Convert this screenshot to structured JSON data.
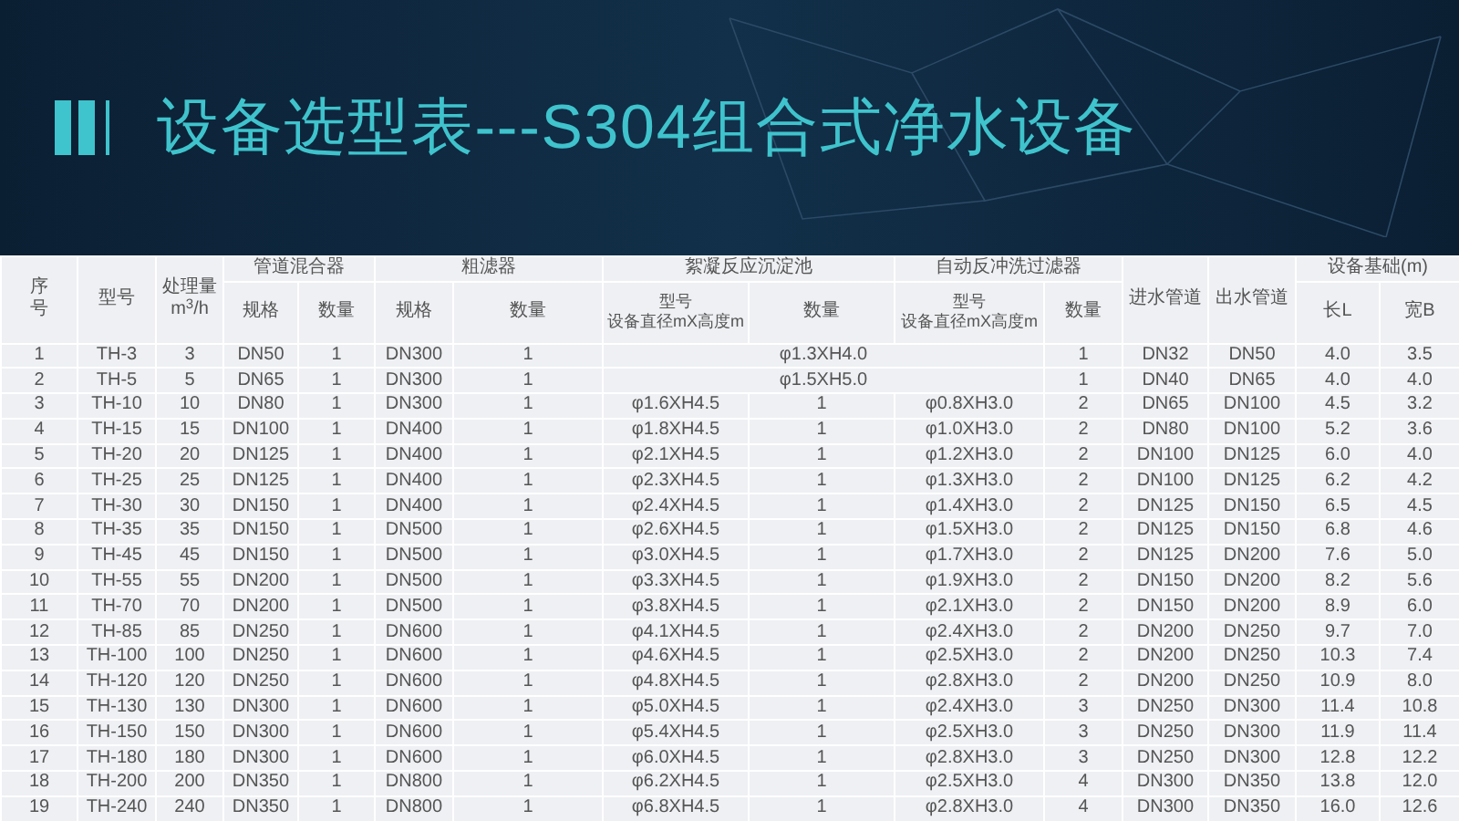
{
  "title": "设备选型表---S304组合式净水设备",
  "header": [
    {
      "kind": "single",
      "label": "序号"
    },
    {
      "kind": "single",
      "label": "型号"
    },
    {
      "kind": "single",
      "label": "处理量\nm$^{3}$/h"
    },
    {
      "kind": "group",
      "label": "管道混合器",
      "columns": [
        "规格",
        "数量"
      ]
    },
    {
      "kind": "group",
      "label": "粗滤器",
      "columns": [
        "规格",
        "数量"
      ]
    },
    {
      "kind": "group",
      "label": "絮凝反应沉淀池",
      "columns": [
        [
          "型号",
          "设备直径mX高度m"
        ],
        "数量"
      ]
    },
    {
      "kind": "group",
      "label": "自动反冲洗过滤器",
      "columns": [
        [
          "型号",
          "设备直径mX高度m"
        ],
        "数量"
      ]
    },
    {
      "kind": "single",
      "label": "进水管道"
    },
    {
      "kind": "single",
      "label": "出水管道"
    },
    {
      "kind": "group",
      "label": "设备基础(m)",
      "columns": [
        "长L",
        "宽B"
      ]
    }
  ],
  "rows": [
    {
      "kind": "merged",
      "before": [
        "1",
        "TH-3",
        "3",
        "DN50",
        "1",
        "DN300",
        "1"
      ],
      "merged": "φ1.3XH4.0",
      "after": [
        "1",
        "DN32",
        "DN50",
        "4.0",
        "3.5"
      ]
    },
    {
      "kind": "merged",
      "before": [
        "2",
        "TH-5",
        "5",
        "DN65",
        "1",
        "DN300",
        "1"
      ],
      "merged": "φ1.5XH5.0",
      "after": [
        "1",
        "DN40",
        "DN65",
        "4.0",
        "4.0"
      ]
    },
    {
      "kind": "standard",
      "cells": [
        "3",
        "TH-10",
        "10",
        "DN80",
        "1",
        "DN300",
        "1",
        "φ1.6XH4.5",
        "1",
        "φ0.8XH3.0",
        "2",
        "DN65",
        "DN100",
        "4.5",
        "3.2"
      ]
    },
    {
      "kind": "standard",
      "cells": [
        "4",
        "TH-15",
        "15",
        "DN100",
        "1",
        "DN400",
        "1",
        "φ1.8XH4.5",
        "1",
        "φ1.0XH3.0",
        "2",
        "DN80",
        "DN100",
        "5.2",
        "3.6"
      ]
    },
    {
      "kind": "standard",
      "cells": [
        "5",
        "TH-20",
        "20",
        "DN125",
        "1",
        "DN400",
        "1",
        "φ2.1XH4.5",
        "1",
        "φ1.2XH3.0",
        "2",
        "DN100",
        "DN125",
        "6.0",
        "4.0"
      ]
    },
    {
      "kind": "standard",
      "cells": [
        "6",
        "TH-25",
        "25",
        "DN125",
        "1",
        "DN400",
        "1",
        "φ2.3XH4.5",
        "1",
        "φ1.3XH3.0",
        "2",
        "DN100",
        "DN125",
        "6.2",
        "4.2"
      ]
    },
    {
      "kind": "standard",
      "cells": [
        "7",
        "TH-30",
        "30",
        "DN150",
        "1",
        "DN400",
        "1",
        "φ2.4XH4.5",
        "1",
        "φ1.4XH3.0",
        "2",
        "DN125",
        "DN150",
        "6.5",
        "4.5"
      ]
    },
    {
      "kind": "standard",
      "cells": [
        "8",
        "TH-35",
        "35",
        "DN150",
        "1",
        "DN500",
        "1",
        "φ2.6XH4.5",
        "1",
        "φ1.5XH3.0",
        "2",
        "DN125",
        "DN150",
        "6.8",
        "4.6"
      ]
    },
    {
      "kind": "standard",
      "cells": [
        "9",
        "TH-45",
        "45",
        "DN150",
        "1",
        "DN500",
        "1",
        "φ3.0XH4.5",
        "1",
        "φ1.7XH3.0",
        "2",
        "DN125",
        "DN200",
        "7.6",
        "5.0"
      ]
    },
    {
      "kind": "standard",
      "cells": [
        "10",
        "TH-55",
        "55",
        "DN200",
        "1",
        "DN500",
        "1",
        "φ3.3XH4.5",
        "1",
        "φ1.9XH3.0",
        "2",
        "DN150",
        "DN200",
        "8.2",
        "5.6"
      ]
    },
    {
      "kind": "standard",
      "cells": [
        "11",
        "TH-70",
        "70",
        "DN200",
        "1",
        "DN500",
        "1",
        "φ3.8XH4.5",
        "1",
        "φ2.1XH3.0",
        "2",
        "DN150",
        "DN200",
        "8.9",
        "6.0"
      ]
    },
    {
      "kind": "standard",
      "cells": [
        "12",
        "TH-85",
        "85",
        "DN250",
        "1",
        "DN600",
        "1",
        "φ4.1XH4.5",
        "1",
        "φ2.4XH3.0",
        "2",
        "DN200",
        "DN250",
        "9.7",
        "7.0"
      ]
    },
    {
      "kind": "standard",
      "cells": [
        "13",
        "TH-100",
        "100",
        "DN250",
        "1",
        "DN600",
        "1",
        "φ4.6XH4.5",
        "1",
        "φ2.5XH3.0",
        "2",
        "DN200",
        "DN250",
        "10.3",
        "7.4"
      ]
    },
    {
      "kind": "standard",
      "cells": [
        "14",
        "TH-120",
        "120",
        "DN250",
        "1",
        "DN600",
        "1",
        "φ4.8XH4.5",
        "1",
        "φ2.8XH3.0",
        "2",
        "DN200",
        "DN250",
        "10.9",
        "8.0"
      ]
    },
    {
      "kind": "standard",
      "cells": [
        "15",
        "TH-130",
        "130",
        "DN300",
        "1",
        "DN600",
        "1",
        "φ5.0XH4.5",
        "1",
        "φ2.4XH3.0",
        "3",
        "DN250",
        "DN300",
        "11.4",
        "10.8"
      ]
    },
    {
      "kind": "standard",
      "cells": [
        "16",
        "TH-150",
        "150",
        "DN300",
        "1",
        "DN600",
        "1",
        "φ5.4XH4.5",
        "1",
        "φ2.5XH3.0",
        "3",
        "DN250",
        "DN300",
        "11.9",
        "11.4"
      ]
    },
    {
      "kind": "standard",
      "cells": [
        "17",
        "TH-180",
        "180",
        "DN300",
        "1",
        "DN600",
        "1",
        "φ6.0XH4.5",
        "1",
        "φ2.8XH3.0",
        "3",
        "DN250",
        "DN300",
        "12.8",
        "12.2"
      ]
    },
    {
      "kind": "standard",
      "cells": [
        "18",
        "TH-200",
        "200",
        "DN350",
        "1",
        "DN800",
        "1",
        "φ6.2XH4.5",
        "1",
        "φ2.5XH3.0",
        "4",
        "DN300",
        "DN350",
        "13.8",
        "12.0"
      ]
    },
    {
      "kind": "standard",
      "cells": [
        "19",
        "TH-240",
        "240",
        "DN350",
        "1",
        "DN800",
        "1",
        "φ6.8XH4.5",
        "1",
        "φ2.8XH3.0",
        "4",
        "DN300",
        "DN350",
        "16.0",
        "12.6"
      ]
    }
  ]
}
